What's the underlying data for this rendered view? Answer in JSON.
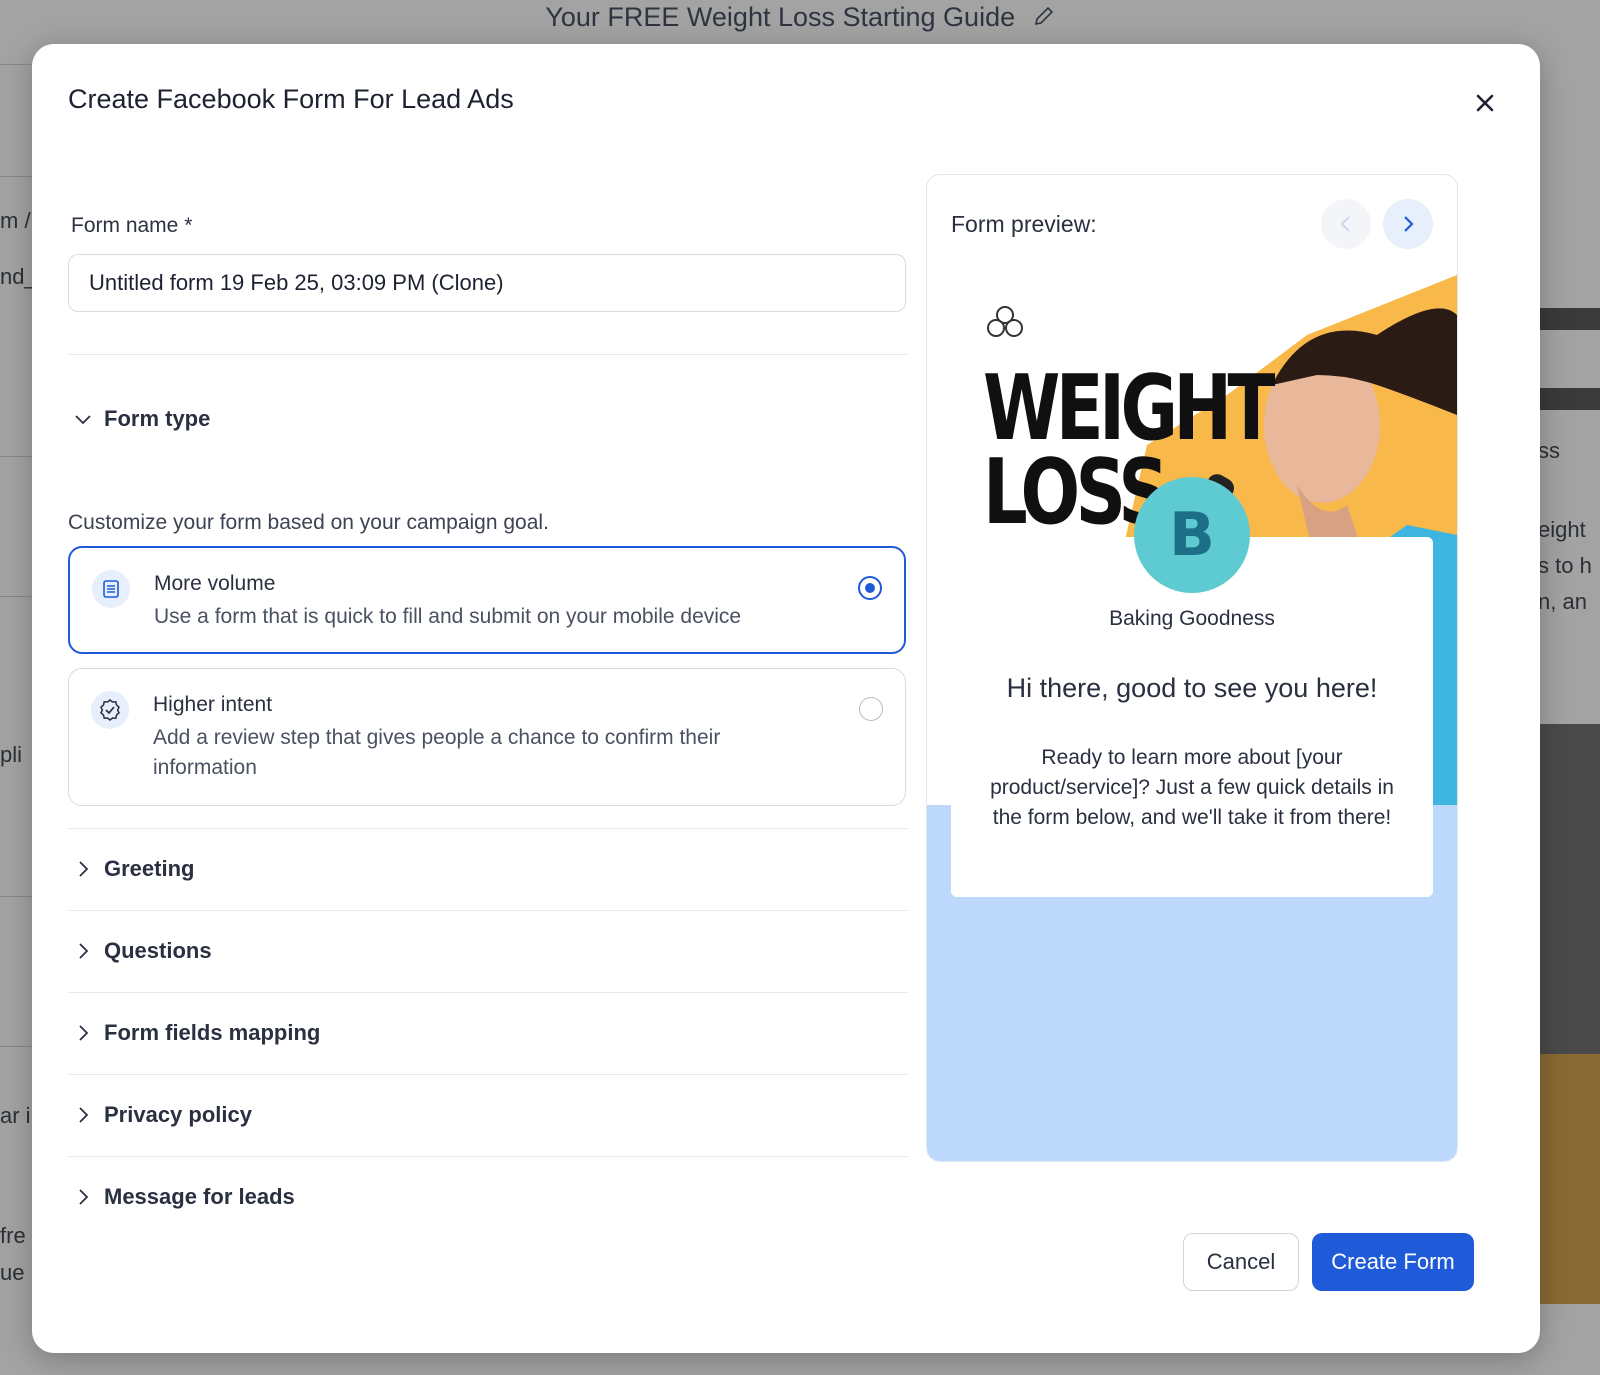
{
  "background": {
    "page_title": "Your FREE Weight Loss Starting Guide",
    "left_fragments": [
      "m /",
      "nd_",
      "pli",
      "ar i",
      "fre",
      "ue i"
    ],
    "right_fragments": [
      "ss",
      "eight",
      "s to h",
      "n, an"
    ]
  },
  "modal": {
    "title": "Create Facebook Form For Lead Ads",
    "form_name": {
      "label": "Form name *",
      "value": "Untitled form 19 Feb 25, 03:09 PM (Clone)"
    },
    "form_type": {
      "heading": "Form type",
      "helper": "Customize your form based on your campaign goal.",
      "options": [
        {
          "title": "More volume",
          "description": "Use a form that is quick to fill and submit on your mobile device",
          "selected": true
        },
        {
          "title": "Higher intent",
          "description": "Add a review step that gives people a chance to confirm their information",
          "selected": false
        }
      ]
    },
    "sections": [
      "Greeting",
      "Questions",
      "Form fields mapping",
      "Privacy policy",
      "Message for leads"
    ],
    "preview": {
      "label": "Form preview:",
      "hero_text_line1": "WEIGHT",
      "hero_text_line2": "LOSS",
      "avatar_letter": "B",
      "brand_name": "Baking Goodness",
      "greeting_title": "Hi there, good to see you here!",
      "greeting_description": "Ready to learn more about [your product/service]? Just a few quick details in the form below, and we'll take it from there!"
    },
    "buttons": {
      "cancel": "Cancel",
      "create": "Create Form"
    }
  },
  "colors": {
    "primary": "#1f5bd8",
    "preview_bg": "#bcd8fb",
    "avatar": "#5ecbd2",
    "splash": "#f8b84a"
  }
}
